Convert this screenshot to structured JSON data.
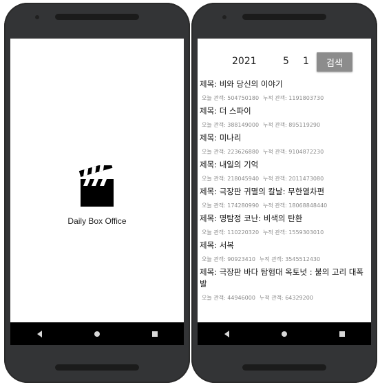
{
  "splash": {
    "app_title": "Daily Box Office",
    "icon": "clapperboard-icon"
  },
  "search": {
    "year": "2021",
    "month": "5",
    "day": "1",
    "button_label": "검색"
  },
  "movies": [
    {
      "title": "제목: 비와 당신의 이야기",
      "today_label": "오늘 관객:",
      "today": "504750180",
      "total_label": "누적 관객:",
      "total": "1191803730"
    },
    {
      "title": "제목: 더 스파이",
      "today_label": "오늘 관객:",
      "today": "388149000",
      "total_label": "누적 관객:",
      "total": "895119290"
    },
    {
      "title": "제목: 미나리",
      "today_label": "오늘 관객:",
      "today": "223626880",
      "total_label": "누적 관객:",
      "total": "9104872230"
    },
    {
      "title": "제목: 내일의 기억",
      "today_label": "오늘 관객:",
      "today": "218045940",
      "total_label": "누적 관객:",
      "total": "2011473080"
    },
    {
      "title": "제목: 극장판 귀멸의 칼날: 무한열차편",
      "today_label": "오늘 관객:",
      "today": "174280990",
      "total_label": "누적 관객:",
      "total": "18068848440"
    },
    {
      "title": "제목: 명탐정 코난: 비색의 탄환",
      "today_label": "오늘 관객:",
      "today": "110220320",
      "total_label": "누적 관객:",
      "total": "1559303010"
    },
    {
      "title": "제목: 서복",
      "today_label": "오늘 관객:",
      "today": "90923410",
      "total_label": "누적 관객:",
      "total": "3545512430"
    },
    {
      "title": "제목: 극장판 바다 탐험대 옥토넛 : 불의 고리 대폭발",
      "today_label": "오늘 관객:",
      "today": "44946000",
      "total_label": "누적 관객:",
      "total": "64329200"
    }
  ],
  "nav": {
    "back_icon": "back-triangle-icon",
    "home_icon": "home-circle-icon",
    "recents_icon": "recents-square-icon",
    "bar_color": "#000000",
    "button_color": "#8c8c8c"
  }
}
